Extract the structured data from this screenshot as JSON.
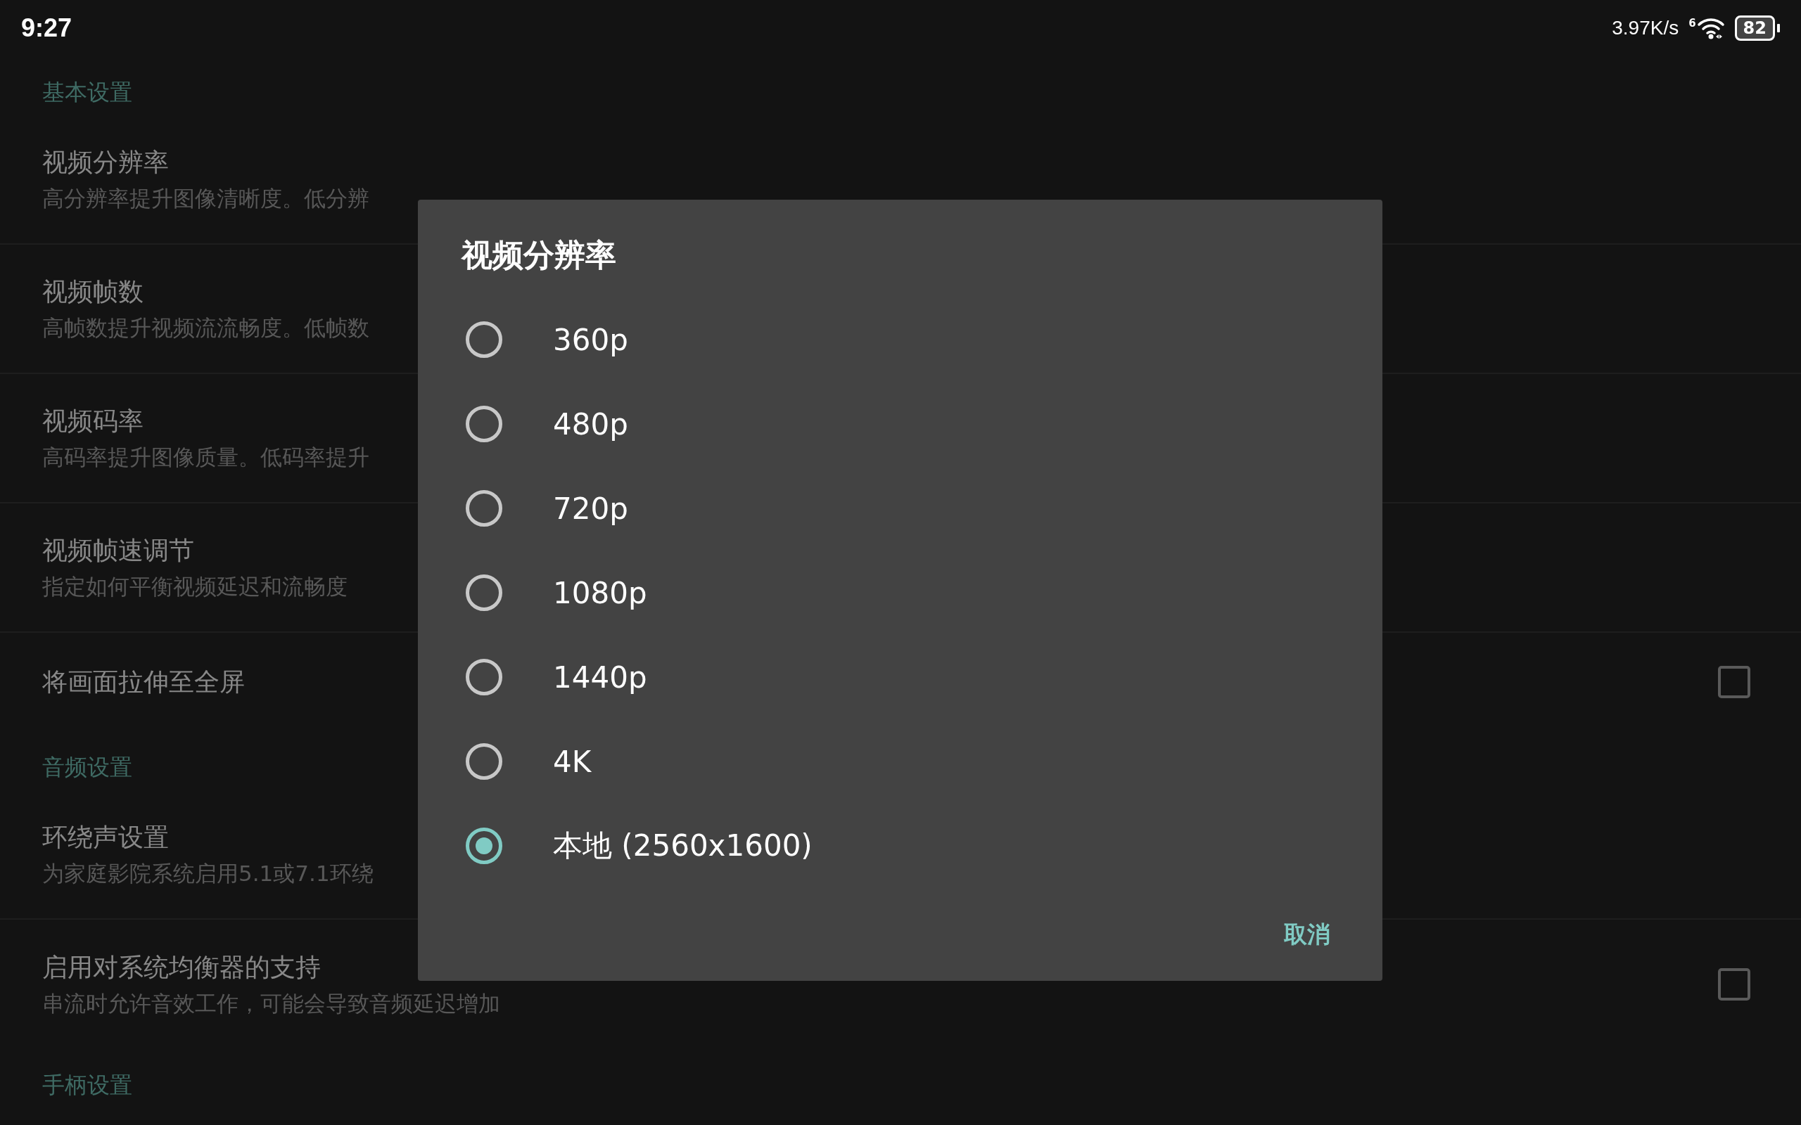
{
  "status_bar": {
    "time": "9:27",
    "speed": "3.97K/s",
    "wifi_badge": "6",
    "battery": "82"
  },
  "settings": [
    {
      "kind": "header",
      "title": "基本设置"
    },
    {
      "kind": "item",
      "title": "视频分辨率",
      "summary": "高分辨率提升图像清晰度。低分辨"
    },
    {
      "kind": "item",
      "title": "视频帧数",
      "summary": "高帧数提升视频流流畅度。低帧数"
    },
    {
      "kind": "item",
      "title": "视频码率",
      "summary": "高码率提升图像质量。低码率提升"
    },
    {
      "kind": "item",
      "title": "视频帧速调节",
      "summary": "指定如何平衡视频延迟和流畅度"
    },
    {
      "kind": "checkbox",
      "title": "将画面拉伸至全屏",
      "checked": false
    },
    {
      "kind": "header",
      "title": "音频设置"
    },
    {
      "kind": "item",
      "title": "环绕声设置",
      "summary": "为家庭影院系统启用5.1或7.1环绕"
    },
    {
      "kind": "checkbox",
      "title": "启用对系统均衡器的支持",
      "summary": "串流时允许音效工作，可能会导致音频延迟增加",
      "checked": false
    },
    {
      "kind": "header",
      "title": "手柄设置"
    }
  ],
  "dialog": {
    "title": "视频分辨率",
    "options": [
      {
        "label": "360p",
        "selected": false
      },
      {
        "label": "480p",
        "selected": false
      },
      {
        "label": "720p",
        "selected": false
      },
      {
        "label": "1080p",
        "selected": false
      },
      {
        "label": "1440p",
        "selected": false
      },
      {
        "label": "4K",
        "selected": false
      },
      {
        "label": "本地 (2560x1600)",
        "selected": true
      }
    ],
    "buttons": [
      "取消"
    ]
  }
}
